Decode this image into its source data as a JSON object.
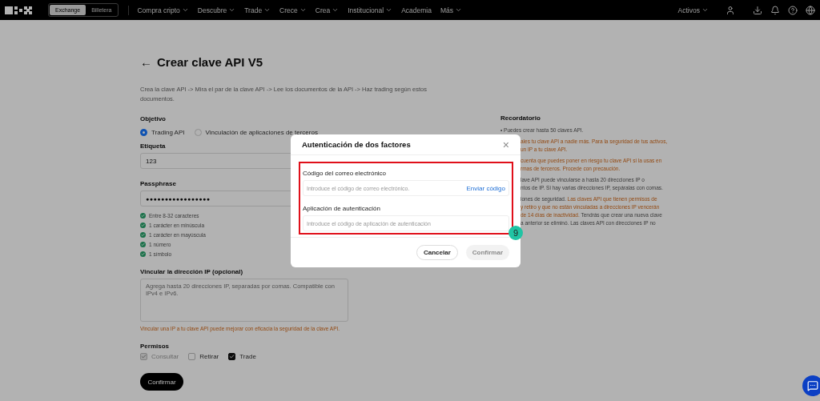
{
  "nav": {
    "modes": [
      {
        "label": "Exchange",
        "selected": true
      },
      {
        "label": "Billetera",
        "selected": false
      }
    ],
    "menu": [
      {
        "label": "Compra cripto",
        "dropdown": true
      },
      {
        "label": "Descubre",
        "dropdown": true
      },
      {
        "label": "Trade",
        "dropdown": true
      },
      {
        "label": "Crece",
        "dropdown": true
      },
      {
        "label": "Crea",
        "dropdown": true
      },
      {
        "label": "Institucional",
        "dropdown": true
      },
      {
        "label": "Academia",
        "dropdown": false
      },
      {
        "label": "Más",
        "dropdown": true
      }
    ],
    "account": {
      "label": "Activos"
    }
  },
  "page": {
    "title": "Crear clave API V5",
    "back": "←",
    "description": "Crea la clave API -> Mira el par de la clave API -> Lee los documentos de la API -> Haz trading según estos documentos.",
    "objective": {
      "label": "Objetivo",
      "options": [
        {
          "label": "Trading API",
          "selected": true
        },
        {
          "label": "Vinculación de aplicaciones de terceros",
          "selected": false
        }
      ]
    },
    "tag": {
      "label": "Etiqueta",
      "value": "123"
    },
    "passphrase": {
      "label": "Passphrase",
      "value": "●●●●●●●●●●●●●●●●●"
    },
    "rules": [
      {
        "label": "Entre 8-32 caracteres",
        "met": true
      },
      {
        "label": "1 carácter en minúscula",
        "met": true
      },
      {
        "label": "1 carácter en mayúscula",
        "met": true
      },
      {
        "label": "1 número",
        "met": true
      },
      {
        "label": "1 símbolo",
        "met": true
      }
    ],
    "ip": {
      "label": "Vincular la dirección IP (opcional)",
      "placeholder": "Agrega hasta 20 direcciones IP, separadas por comas. Compatible con IPv4 e IPv6.",
      "hint": "Vincular una IP a tu clave API puede mejorar con eficacia la seguridad de la clave API."
    },
    "permissions": {
      "label": "Permisos",
      "items": [
        {
          "label": "Consultar",
          "checked": true,
          "disabled": true
        },
        {
          "label": "Retirar",
          "checked": false,
          "disabled": false
        },
        {
          "label": "Trade",
          "checked": true,
          "disabled": false
        }
      ]
    },
    "submit": "Confirmar"
  },
  "reminder": {
    "title": "Recordatorio",
    "items": [
      {
        "lines": [
          [
            {
              "text": "• Puedes crear hasta 50 claves API.",
              "kind": "normal"
            }
          ]
        ]
      },
      {
        "lines": [
          [
            {
              "text": "ales tu clave API a nadie más. Para la seguridad de tus activos,",
              "kind": "warning"
            }
          ],
          [
            {
              "text": "un IP a tu clave API.",
              "kind": "warning"
            }
          ]
        ]
      },
      {
        "lines": [
          [
            {
              "text": "cuenta que puedes poner en riesgo tu clave API si la usas en",
              "kind": "warning"
            }
          ],
          [
            {
              "text": "rmas de terceros. Procede con precaución.",
              "kind": "warning"
            }
          ]
        ]
      },
      {
        "lines": [
          [
            {
              "text": "lave API puede vincularse a hasta 20 direcciones IP o",
              "kind": "normal"
            }
          ],
          [
            {
              "text": "ntos de IP. Si hay varias direcciones IP, sepáralas con comas.",
              "kind": "normal"
            }
          ]
        ]
      },
      {
        "lines": [
          [
            {
              "text": "iones de seguridad. ",
              "kind": "normal"
            },
            {
              "text": "Las claves API que tienen permisos de",
              "kind": "warning"
            }
          ],
          [
            {
              "text": "y retiro y que no están vinculadas a direcciones IP vencerán",
              "kind": "warning"
            }
          ],
          [
            {
              "text": "de 14 días de inactividad.",
              "kind": "warning"
            },
            {
              "text": " Tendrás que crear una nueva clave",
              "kind": "normal"
            }
          ],
          [
            {
              "text": "a anterior se eliminó. Las claves API con direcciones IP no",
              "kind": "normal"
            }
          ]
        ]
      }
    ]
  },
  "dialog": {
    "title": "Autenticación de dos factores",
    "close": "×",
    "fields": [
      {
        "label": "Código del correo electrónico",
        "placeholder": "Introduce el código de correo electrónico.",
        "action": "Enviar código"
      },
      {
        "label": "Aplicación de autenticación",
        "placeholder": "Introduce el código de aplicación de autenticación"
      }
    ],
    "annotation": {
      "label": "9"
    },
    "buttons": [
      {
        "label": "Cancelar",
        "disabled": false
      },
      {
        "label": "Confirmar",
        "disabled": true
      }
    ]
  }
}
